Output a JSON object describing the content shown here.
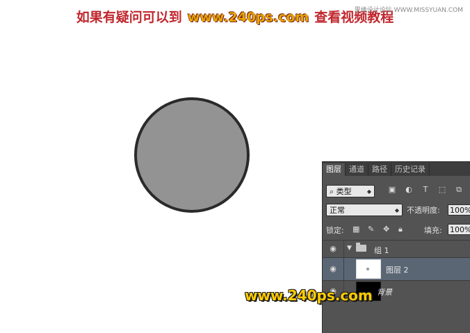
{
  "banner": {
    "part1": "如果有疑问可以到",
    "part2": "www.240ps.com",
    "part3": "查看视频教程",
    "watermark_top": "思缘设计论坛 WWW.MISSYUAN.COM"
  },
  "canvas": {
    "circle_fill": "#939393",
    "circle_stroke": "#2a2a2a"
  },
  "panel": {
    "tabs": [
      "图层",
      "通道",
      "路径",
      "历史记录"
    ],
    "active_tab": 0,
    "filter_label": "类型",
    "filter_icons": [
      "image-filter-icon",
      "adjustment-filter-icon",
      "type-filter-icon",
      "shape-filter-icon",
      "smart-object-filter-icon"
    ],
    "blend_mode": "正常",
    "opacity_label": "不透明度:",
    "opacity_value": "100%",
    "lock_label": "锁定:",
    "fill_label": "填充:",
    "fill_value": "100%",
    "layers": [
      {
        "name": "组 1",
        "type": "group"
      },
      {
        "name": "图层 2",
        "type": "layer",
        "selected": true
      },
      {
        "name": "背景",
        "type": "background"
      }
    ]
  },
  "bottom_watermark": "www.240ps.com",
  "colors": {
    "panel_bg": "#535353",
    "selected_row": "#5b6675",
    "banner_red": "#c0272d",
    "banner_gold": "#e6a700",
    "watermark_yellow": "#ffcc00"
  }
}
